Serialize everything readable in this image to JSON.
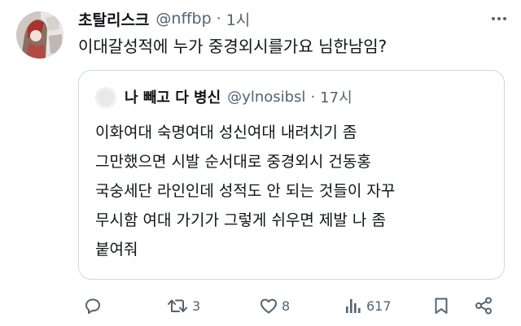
{
  "post": {
    "author": {
      "display_name": "초탈리스크",
      "handle": "@nffbp",
      "separator": "·",
      "time": "1시"
    },
    "text": "이대갈성적에 누가 중경외시를가요 님한남임?",
    "quoted": {
      "author": {
        "display_name": "나 빼고 다 병신",
        "handle": "@ylnosibsl",
        "separator": "·",
        "time": "17시"
      },
      "lines": [
        "이화여대 숙명여대 성신여대 내려치기 좀",
        "그만했으면 시발 순서대로 중경외시 건동홍",
        "국숭세단 라인인데 성적도 안 되는 것들이 자꾸",
        "무시함 여대 가기가 그렇게 쉬우면 제발 나 좀",
        "붙여줘"
      ]
    },
    "actions": {
      "reply": {
        "icon": "reply-icon",
        "count": ""
      },
      "repost": {
        "icon": "repost-icon",
        "count": "3"
      },
      "like": {
        "icon": "heart-icon",
        "count": "8"
      },
      "views": {
        "icon": "views-icon",
        "count": "617"
      },
      "bookmark": {
        "icon": "bookmark-icon"
      },
      "share": {
        "icon": "share-icon"
      }
    }
  },
  "colors": {
    "text": "#0f1419",
    "secondary": "#536471",
    "border": "#cfd9de",
    "background": "#ffffff"
  }
}
